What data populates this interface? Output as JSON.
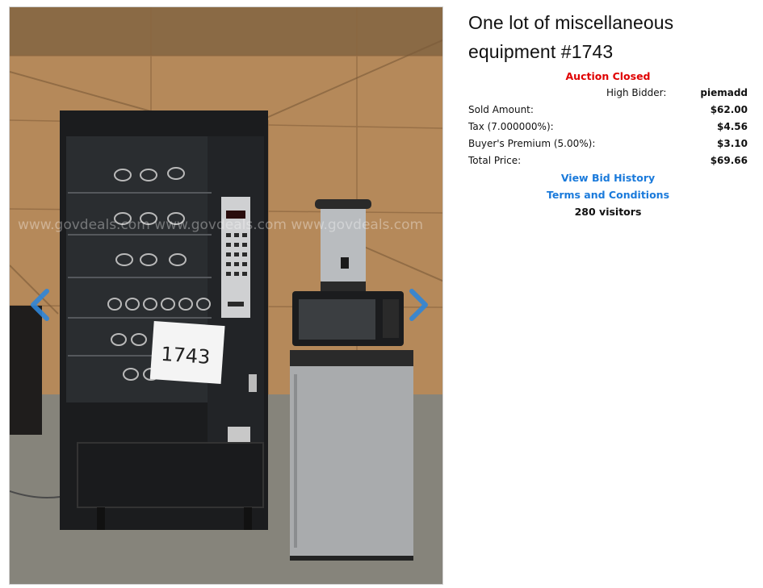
{
  "listing": {
    "title": "One lot of miscellaneous equipment #1743",
    "status": "Auction Closed",
    "high_bidder_label": "High Bidder:",
    "high_bidder_value": "piemadd",
    "rows": [
      {
        "label": "Sold Amount:",
        "value": "$62.00"
      },
      {
        "label": "Tax (7.000000%):",
        "value": "$4.56"
      },
      {
        "label": "Buyer's Premium (5.00%):",
        "value": "$3.10"
      },
      {
        "label": "Total Price:",
        "value": "$69.66"
      }
    ],
    "links": {
      "bid_history": "View Bid History",
      "terms": "Terms and Conditions"
    },
    "visitors": "280 visitors"
  },
  "photo": {
    "lot_tag_text": "1743",
    "watermark_text": "www.govdeals.com www.govdeals.com www.govdeals.com"
  },
  "colors": {
    "status_red": "#e00000",
    "link_blue": "#1a7adb",
    "arrow_blue": "#2f86d8"
  },
  "icons": {
    "prev": "chevron-left-icon",
    "next": "chevron-right-icon"
  }
}
